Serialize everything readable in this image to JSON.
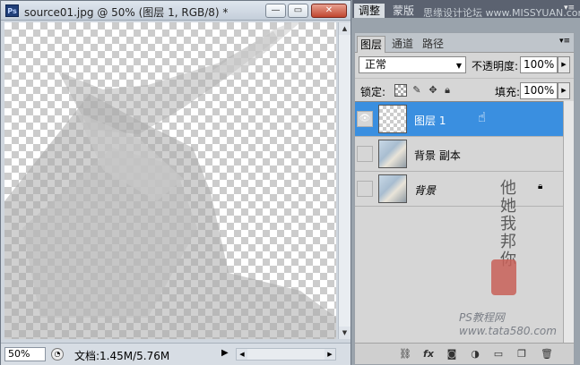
{
  "window": {
    "logo": "Ps",
    "title": "source01.jpg @ 50% (图层 1, RGB/8) *",
    "buttons": {
      "minimize": "—",
      "maximize": "▭",
      "close": "✕"
    }
  },
  "statusbar": {
    "zoom": "50%",
    "doc_size": "文档:1.45M/5.76M",
    "menu_arrow": "▶"
  },
  "panel_tabs": [
    "调整",
    "蒙版"
  ],
  "top_watermark": "思缘设计论坛 www.MISSYUAN.com",
  "layers_panel": {
    "tabs": [
      "图层",
      "通道",
      "路径"
    ],
    "blend_mode": "正常",
    "opacity_label": "不透明度:",
    "opacity_value": "100%",
    "lock_label": "锁定:",
    "fill_label": "填充:",
    "fill_value": "100%",
    "layers": [
      {
        "name": "图层 1",
        "selected": true,
        "visible": true
      },
      {
        "name": "背景 副本",
        "selected": false,
        "visible": false
      },
      {
        "name": "背景",
        "selected": false,
        "visible": false,
        "locked": true
      }
    ],
    "footer_tools": [
      "link-icon",
      "fx-icon",
      "mask-icon",
      "adjustment-icon",
      "folder-icon",
      "new-layer-icon",
      "trash-icon"
    ]
  },
  "footer_watermark": "PS教程网  www.tata580.com",
  "colors": {
    "selection": "#3a8fe0",
    "panel_bg": "#d6d6d6",
    "seal": "#c86058"
  }
}
